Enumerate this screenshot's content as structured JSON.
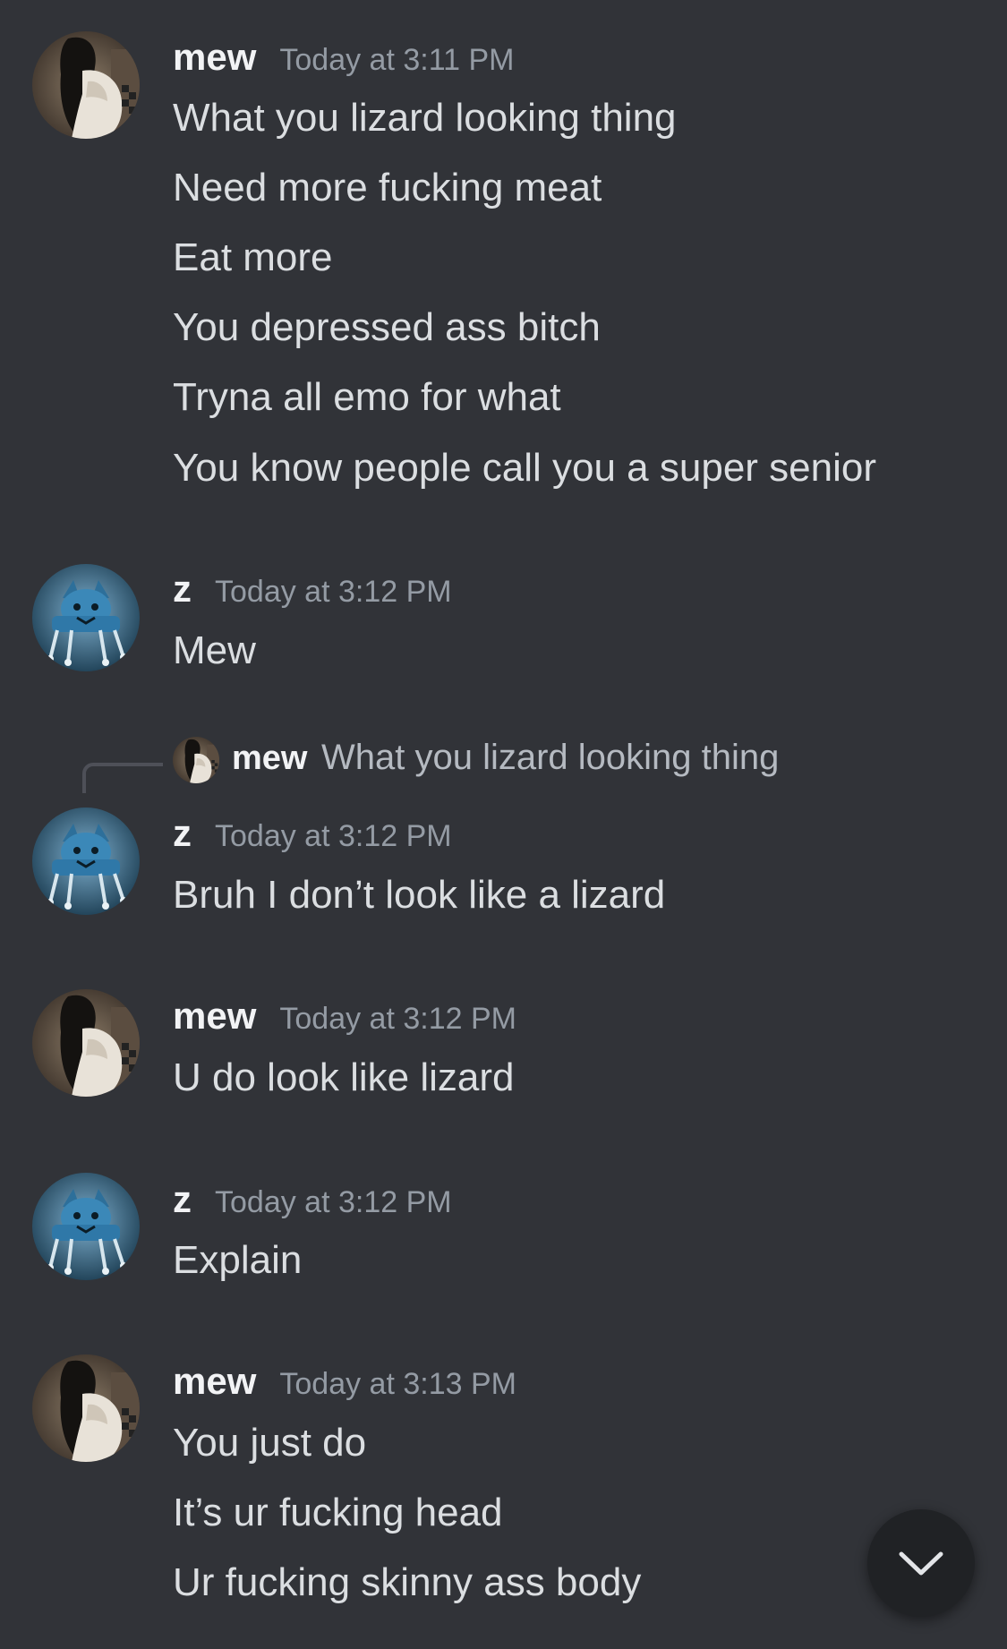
{
  "messages": [
    {
      "username": "mew",
      "timestamp": "Today at 3:11 PM",
      "avatar": "mew-avatar",
      "lines": [
        "What you lizard looking thing",
        "Need more fucking meat",
        "Eat more",
        "You depressed ass bitch",
        "Tryna all emo for what",
        "You know people call you a super senior"
      ]
    },
    {
      "username": "z",
      "timestamp": "Today at 3:12 PM",
      "avatar": "z-avatar",
      "lines": [
        "Mew"
      ]
    },
    {
      "username": "z",
      "timestamp": "Today at 3:12 PM",
      "avatar": "z-avatar",
      "reply": {
        "username": "mew",
        "text": "What you lizard looking thing"
      },
      "lines": [
        "Bruh I don’t look like a lizard"
      ]
    },
    {
      "username": "mew",
      "timestamp": "Today at 3:12 PM",
      "avatar": "mew-avatar",
      "lines": [
        "U do look like lizard"
      ]
    },
    {
      "username": "z",
      "timestamp": "Today at 3:12 PM",
      "avatar": "z-avatar",
      "lines": [
        "Explain"
      ]
    },
    {
      "username": "mew",
      "timestamp": "Today at 3:13 PM",
      "avatar": "mew-avatar",
      "lines": [
        "You just do",
        "It’s ur fucking head",
        "Ur fucking skinny ass body"
      ]
    }
  ],
  "scroll_button": {
    "icon": "chevron-down-icon"
  },
  "colors": {
    "background": "#313338",
    "username": "#f2f3f5",
    "timestamp": "#949ba4",
    "message_text": "#dbdee1",
    "scroll_button": "#202225"
  }
}
